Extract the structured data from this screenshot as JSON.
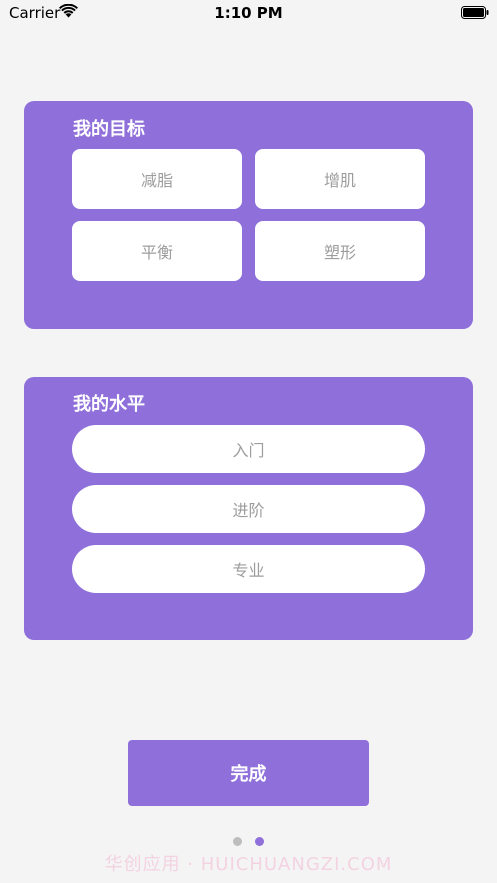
{
  "status_bar": {
    "carrier": "Carrier",
    "time": "1:10 PM",
    "icons": [
      "wifi-icon",
      "battery-icon"
    ]
  },
  "goal_card": {
    "title": "我的目标",
    "options": [
      "减脂",
      "增肌",
      "平衡",
      "塑形"
    ]
  },
  "level_card": {
    "title": "我的水平",
    "options": [
      "入门",
      "进阶",
      "专业"
    ]
  },
  "done_button": "完成",
  "pager": {
    "count": 2,
    "active_index": 1
  },
  "watermark": "华创应用 · HUICHUANGZI.COM",
  "colors": {
    "accent": "#8f6fda",
    "background": "#f4f4f4",
    "option_text": "#9d9d9d",
    "inactive_dot": "#bdbdbd"
  }
}
